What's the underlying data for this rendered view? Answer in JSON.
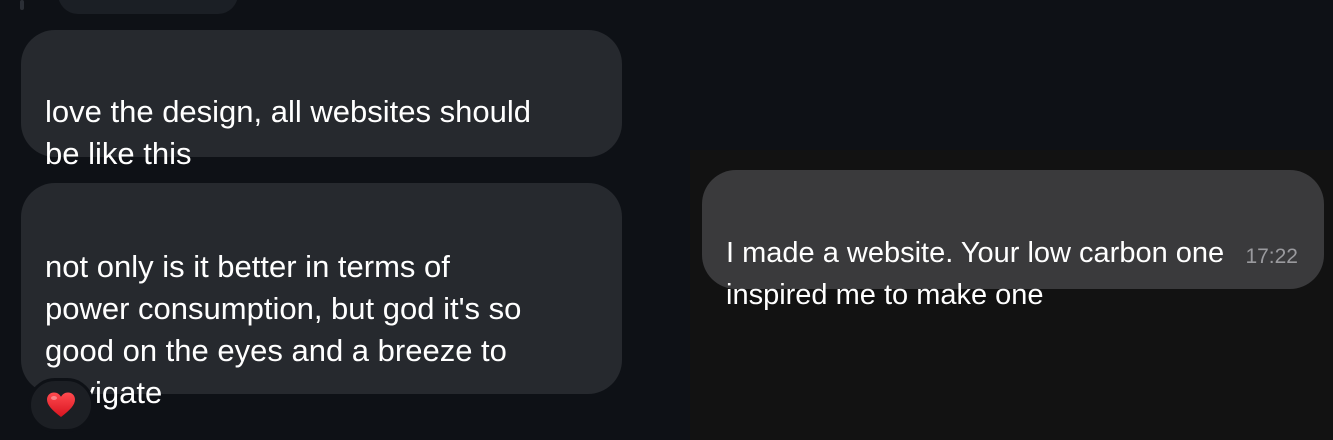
{
  "messages": [
    {
      "direction": "incoming",
      "text": "love the design, all websites should\nbe like this"
    },
    {
      "direction": "incoming",
      "text": "not only is it better in terms of\npower consumption, but god it's so\ngood on the eyes and a breeze to\nnavigate",
      "reaction": "heart-icon"
    },
    {
      "direction": "outgoing",
      "text": "I made a website. Your low carbon one\ninspired me to make one",
      "time": "17:22"
    }
  ],
  "colors": {
    "background": "#0e1116",
    "incoming_bubble": "#26292e",
    "outgoing_bubble": "#3a3a3c",
    "timestamp": "#9a9a9e",
    "reaction_heart": "#e8202e"
  }
}
